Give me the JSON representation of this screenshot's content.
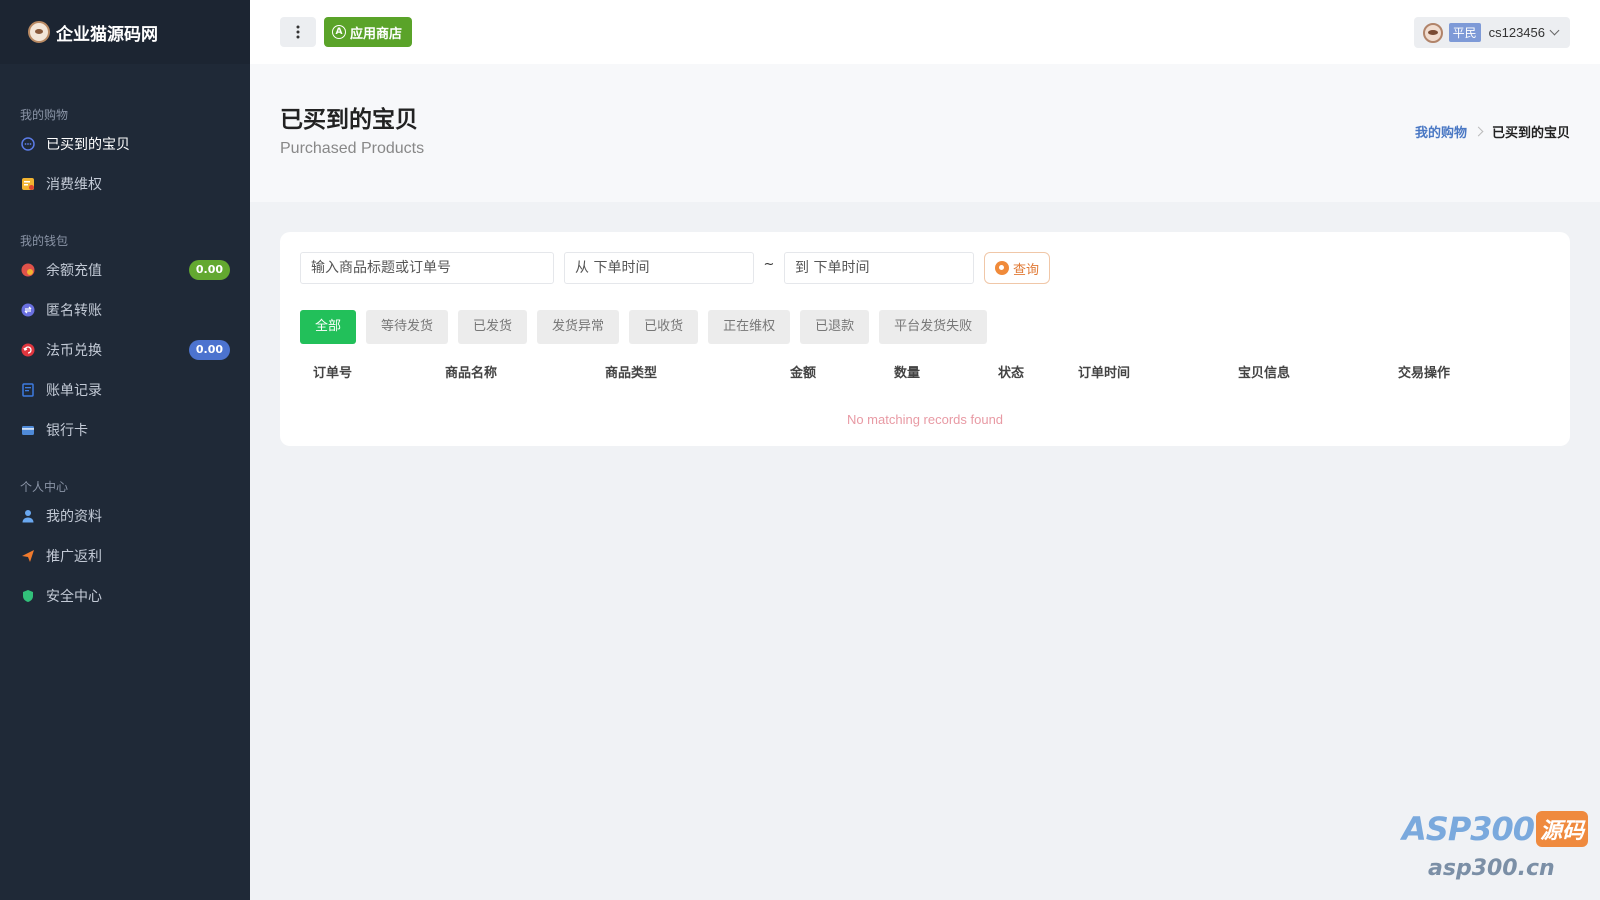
{
  "brand": {
    "name": "企业猫源码网"
  },
  "sidebar": {
    "groups": [
      {
        "title": "我的购物",
        "items": [
          {
            "label": "已买到的宝贝",
            "icon": "circle-dots-icon",
            "active": true
          },
          {
            "label": "消费维权",
            "icon": "receipt-icon"
          }
        ]
      },
      {
        "title": "我的钱包",
        "items": [
          {
            "label": "余额充值",
            "icon": "coin-icon",
            "badge": "0.00",
            "badge_color": "#63a830"
          },
          {
            "label": "匿名转账",
            "icon": "transfer-icon"
          },
          {
            "label": "法币兑换",
            "icon": "exchange-icon",
            "badge": "0.00",
            "badge_color": "#4c73cf"
          },
          {
            "label": "账单记录",
            "icon": "bill-icon"
          },
          {
            "label": "银行卡",
            "icon": "card-icon"
          }
        ]
      },
      {
        "title": "个人中心",
        "items": [
          {
            "label": "我的资料",
            "icon": "user-icon"
          },
          {
            "label": "推广返利",
            "icon": "paper-plane-icon"
          },
          {
            "label": "安全中心",
            "icon": "shield-icon"
          }
        ]
      }
    ]
  },
  "topbar": {
    "app_store_label": "应用商店",
    "user": {
      "role": "平民",
      "username": "cs123456"
    }
  },
  "page": {
    "title": "已买到的宝贝",
    "subtitle": "Purchased Products",
    "breadcrumb": {
      "parent": "我的购物",
      "current": "已买到的宝贝"
    }
  },
  "search": {
    "keyword_placeholder": "输入商品标题或订单号",
    "from_placeholder": "从 下单时间",
    "separator": "~",
    "to_placeholder": "到 下单时间",
    "query_label": "查询"
  },
  "tabs": [
    "全部",
    "等待发货",
    "已发货",
    "发货异常",
    "已收货",
    "正在维权",
    "已退款",
    "平台发货失败"
  ],
  "table": {
    "columns": [
      "订单号",
      "商品名称",
      "商品类型",
      "金额",
      "数量",
      "状态",
      "订单时间",
      "宝贝信息",
      "交易操作"
    ],
    "empty_text": "No matching records found"
  },
  "watermark": {
    "brand": "ASP300",
    "badge": "源码",
    "url": "asp300.cn"
  },
  "colors": {
    "accent_green": "#22c05a",
    "sidebar_bg": "#1f2937",
    "app_store_green": "#5aa329"
  }
}
